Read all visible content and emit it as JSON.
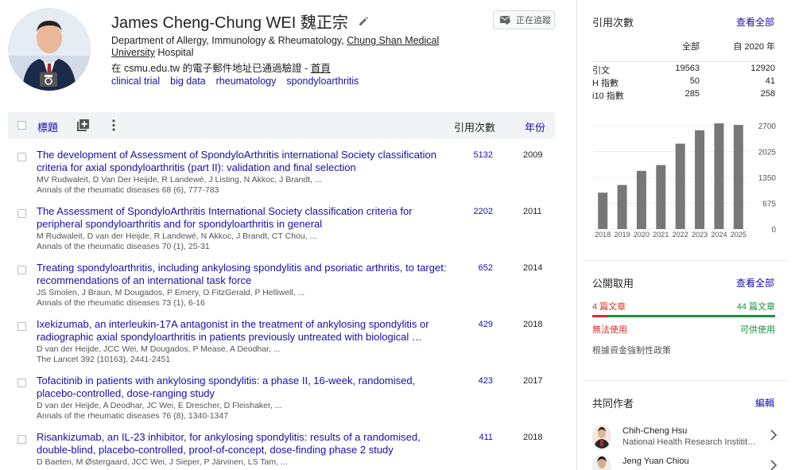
{
  "profile": {
    "name": "James Cheng-Chung WEI 魏正宗",
    "affiliation_prefix": "Department of Allergy, Immunology & Rheumatology, ",
    "affiliation_link": "Chung Shan Medical University",
    "affiliation_suffix": " Hospital",
    "verified_prefix": "在 csmu.edu.tw 的電子郵件地址已通過驗證 - ",
    "homepage_link": "首頁",
    "interests": [
      "clinical trial",
      "big data",
      "rheumatology",
      "spondyloarthritis"
    ],
    "follow_label": "正在追蹤"
  },
  "table_header": {
    "title": "標題",
    "cited_by": "引用次數",
    "year": "年份"
  },
  "articles": [
    {
      "title": "The development of Assessment of SpondyloArthritis international Society classification criteria for axial spondyloarthritis (part II): validation and final selection",
      "authors": "MV Rudwaleit, D Van Der Heijde, R Landewé, J Listing, N Akkoc, J Brandt, ...",
      "venue": "Annals of the rheumatic diseases 68 (6), 777-783",
      "cited": "5132",
      "year": "2009"
    },
    {
      "title": "The Assessment of SpondyloArthritis International Society classification criteria for peripheral spondyloarthritis and for spondyloarthritis in general",
      "authors": "M Rudwaleit, D van der Heijde, R Landewé, N Akkoc, J Brandt, CT Chou, ...",
      "venue": "Annals of the rheumatic diseases 70 (1), 25-31",
      "cited": "2202",
      "year": "2011"
    },
    {
      "title": "Treating spondyloarthritis, including ankylosing spondylitis and psoriatic arthritis, to target: recommendations of an international task force",
      "authors": "JS Smolen, J Braun, M Dougados, P Emery, O FitzGerald, P Helliwell, ...",
      "venue": "Annals of the rheumatic diseases 73 (1), 6-16",
      "cited": "652",
      "year": "2014"
    },
    {
      "title": "Ixekizumab, an interleukin-17A antagonist in the treatment of ankylosing spondylitis or radiographic axial spondyloarthritis in patients previously untreated with biological …",
      "authors": "D van der Heijde, JCC Wei, M Dougados, P Mease, A Deodhar, ...",
      "venue": "The Lancet 392 (10163), 2441-2451",
      "cited": "429",
      "year": "2018"
    },
    {
      "title": "Tofacitinib in patients with ankylosing spondylitis: a phase II, 16-week, randomised, placebo-controlled, dose-ranging study",
      "authors": "D van der Heijde, A Deodhar, JC Wei, E Drescher, D Fleishaker, ...",
      "venue": "Annals of the rheumatic diseases 76 (8), 1340-1347",
      "cited": "423",
      "year": "2017"
    },
    {
      "title": "Risankizumab, an IL-23 inhibitor, for ankylosing spondylitis: results of a randomised, double-blind, placebo-controlled, proof-of-concept, dose-finding phase 2 study",
      "authors": "D Baeten, M Østergaard, JCC Wei, J Sieper, P Järvinen, LS Tam, ...",
      "venue": "",
      "cited": "411",
      "year": "2018"
    }
  ],
  "citations": {
    "heading": "引用次數",
    "view_all": "查看全部",
    "col_all": "全部",
    "col_since": "自 2020 年",
    "rows": [
      {
        "label": "引文",
        "all": "19563",
        "since": "12920"
      },
      {
        "label": "H 指數",
        "all": "50",
        "since": "41"
      },
      {
        "label": "i10 指數",
        "all": "285",
        "since": "258"
      }
    ]
  },
  "chart_data": {
    "type": "bar",
    "categories": [
      "2018",
      "2019",
      "2020",
      "2021",
      "2022",
      "2023",
      "2024",
      "2025"
    ],
    "values": [
      950,
      1150,
      1520,
      1670,
      2230,
      2580,
      2760,
      2720
    ],
    "y_ticks": [
      "2700",
      "2025",
      "1350",
      "675",
      "0"
    ],
    "ylim": [
      0,
      2700
    ],
    "bar_color": "#777777"
  },
  "public_access": {
    "heading": "公開取用",
    "view_all": "查看全部",
    "unavailable_count": "4 篇文章",
    "available_count": "44 篇文章",
    "unavailable_label": "無法使用",
    "available_label": "可供使用",
    "unavailable_fraction": 0.083,
    "note": "根據資金強制性政策",
    "red": "#d93025",
    "green": "#1e8e3e"
  },
  "coauthors": {
    "heading": "共同作者",
    "edit": "編輯",
    "items": [
      {
        "name": "Chih-Cheng Hsu",
        "affiliation": "National Health Research Institit…"
      },
      {
        "name": "Jeng Yuan Chiou",
        "affiliation": ""
      }
    ]
  }
}
